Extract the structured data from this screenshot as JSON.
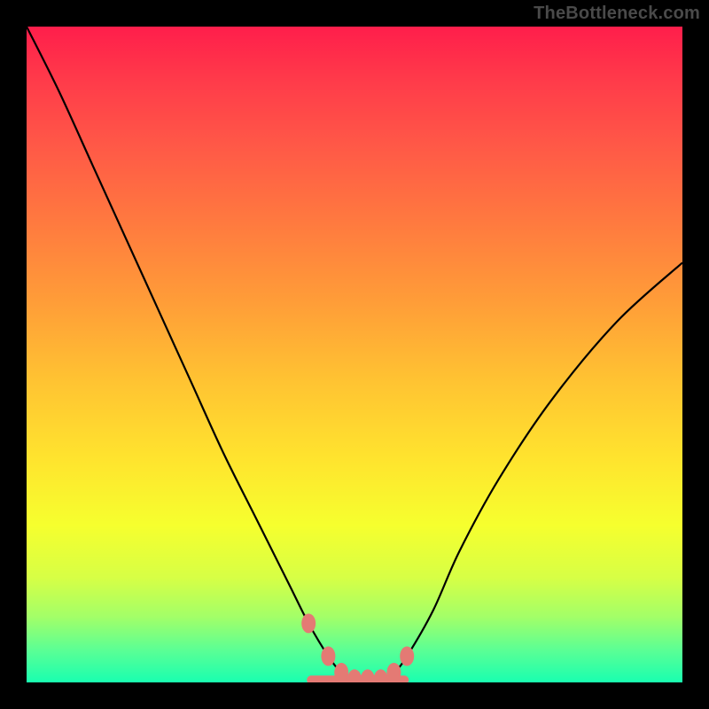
{
  "watermark": "TheBottleneck.com",
  "chart_data": {
    "type": "line",
    "title": "",
    "xlabel": "",
    "ylabel": "",
    "xlim": [
      0,
      100
    ],
    "ylim": [
      0,
      100
    ],
    "grid": false,
    "legend": false,
    "series": [
      {
        "name": "bottleneck-curve",
        "x": [
          0,
          5,
          10,
          15,
          20,
          25,
          30,
          35,
          40,
          43,
          46,
          48,
          50,
          52,
          54,
          56,
          58,
          62,
          66,
          72,
          80,
          90,
          100
        ],
        "values": [
          100,
          90,
          79,
          68,
          57,
          46,
          35,
          25,
          15,
          9,
          4,
          1.5,
          0.5,
          0.5,
          0.5,
          1.5,
          4,
          11,
          20,
          31,
          43,
          55,
          64
        ],
        "color": "#000000"
      },
      {
        "name": "bottom-markers",
        "type": "scatter",
        "x": [
          43,
          46,
          48,
          50,
          52,
          54,
          56,
          58
        ],
        "values": [
          9,
          4,
          1.5,
          0.5,
          0.5,
          0.5,
          1.5,
          4
        ],
        "marker": "bead",
        "color": "#e47a74"
      }
    ],
    "gradient_background": {
      "top": "#ff1e4b",
      "bottom": "#19ffb0"
    }
  }
}
